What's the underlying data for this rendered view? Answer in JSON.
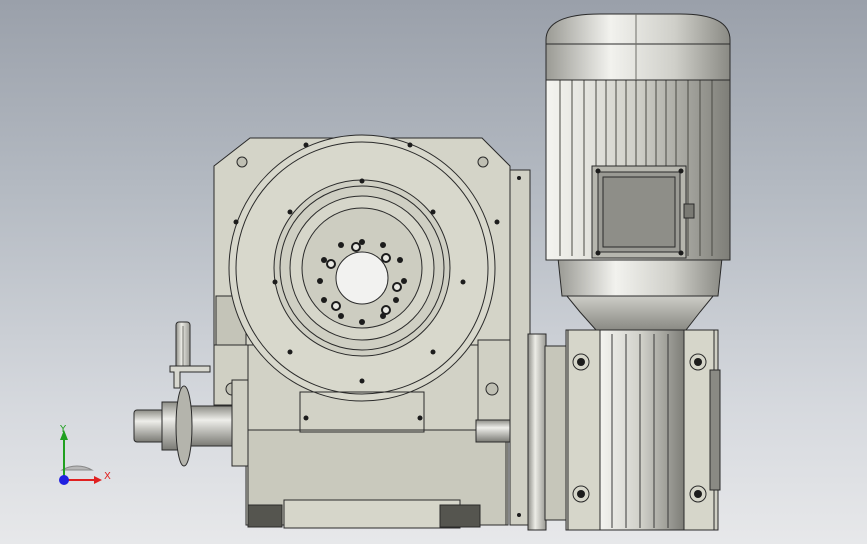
{
  "viewport": {
    "background_top": "#9aa0aa",
    "background_bottom": "#e7e8ea"
  },
  "model": {
    "parts": [
      "rotary-indexer-housing",
      "rotary-table",
      "input-shaft",
      "gear-reducer",
      "electric-motor",
      "terminal-box",
      "handle"
    ],
    "colors": {
      "body": "#d2d2c6",
      "body_dark": "#8c8c82",
      "edge": "#2a2a2a",
      "metal_light": "#e6e6e0",
      "hole": "#1c1c1c"
    }
  },
  "triad": {
    "x_label": "X",
    "y_label": "Y",
    "x_color": "#e02020",
    "y_color": "#20a020",
    "z_color": "#2020e0"
  }
}
